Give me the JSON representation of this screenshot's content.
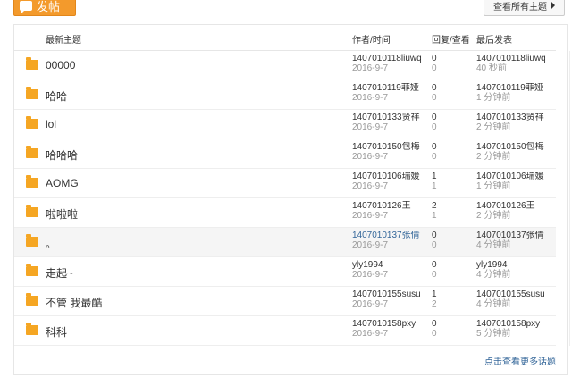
{
  "header": {
    "post_label": "发帖",
    "view_all_label": "查看所有主题"
  },
  "table": {
    "col_topic": "最新主题",
    "col_author": "作者/时间",
    "col_reply": "回复/查看",
    "col_last": "最后发表"
  },
  "rows": [
    {
      "topic": "00000",
      "author": "1407010118liuwq",
      "date": "2016-9-7",
      "replies": "0",
      "views": "0",
      "last_user": "1407010118liuwq",
      "last_time": "40 秒前"
    },
    {
      "topic": "哈哈",
      "author": "1407010119菲娅",
      "date": "2016-9-7",
      "replies": "0",
      "views": "0",
      "last_user": "1407010119菲娅",
      "last_time": "1 分钟前"
    },
    {
      "topic": "lol",
      "author": "1407010133贤祥",
      "date": "2016-9-7",
      "replies": "0",
      "views": "0",
      "last_user": "1407010133贤祥",
      "last_time": "2 分钟前"
    },
    {
      "topic": "哈哈哈",
      "author": "1407010150包梅",
      "date": "2016-9-7",
      "replies": "0",
      "views": "0",
      "last_user": "1407010150包梅",
      "last_time": "2 分钟前"
    },
    {
      "topic": "AOMG",
      "author": "1407010106瑞媛",
      "date": "2016-9-7",
      "replies": "1",
      "views": "1",
      "last_user": "1407010106瑞媛",
      "last_time": "1 分钟前"
    },
    {
      "topic": "啦啦啦",
      "author": "1407010126王",
      "date": "2016-9-7",
      "replies": "2",
      "views": "1",
      "last_user": "1407010126王",
      "last_time": "2 分钟前"
    },
    {
      "topic": "。",
      "author": "1407010137张倩",
      "date": "2016-9-7",
      "replies": "0",
      "views": "0",
      "last_user": "1407010137张倩",
      "last_time": "4 分钟前"
    },
    {
      "topic": "走起~",
      "author": "yly1994",
      "date": "2016-9-7",
      "replies": "0",
      "views": "0",
      "last_user": "yly1994",
      "last_time": "4 分钟前"
    },
    {
      "topic": "不管 我最酷",
      "author": "1407010155susu",
      "date": "2016-9-7",
      "replies": "1",
      "views": "2",
      "last_user": "1407010155susu",
      "last_time": "4 分钟前"
    },
    {
      "topic": "科科",
      "author": "1407010158pxy",
      "date": "2016-9-7",
      "replies": "0",
      "views": "0",
      "last_user": "1407010158pxy",
      "last_time": "5 分钟前"
    }
  ],
  "footer": {
    "more_label": "点击查看更多话题"
  },
  "icons": {
    "topic_icon": "folder-icon",
    "post_icon": "speech-bubble-icon"
  },
  "colors": {
    "accent": "#f39a2c",
    "link": "#336699"
  }
}
